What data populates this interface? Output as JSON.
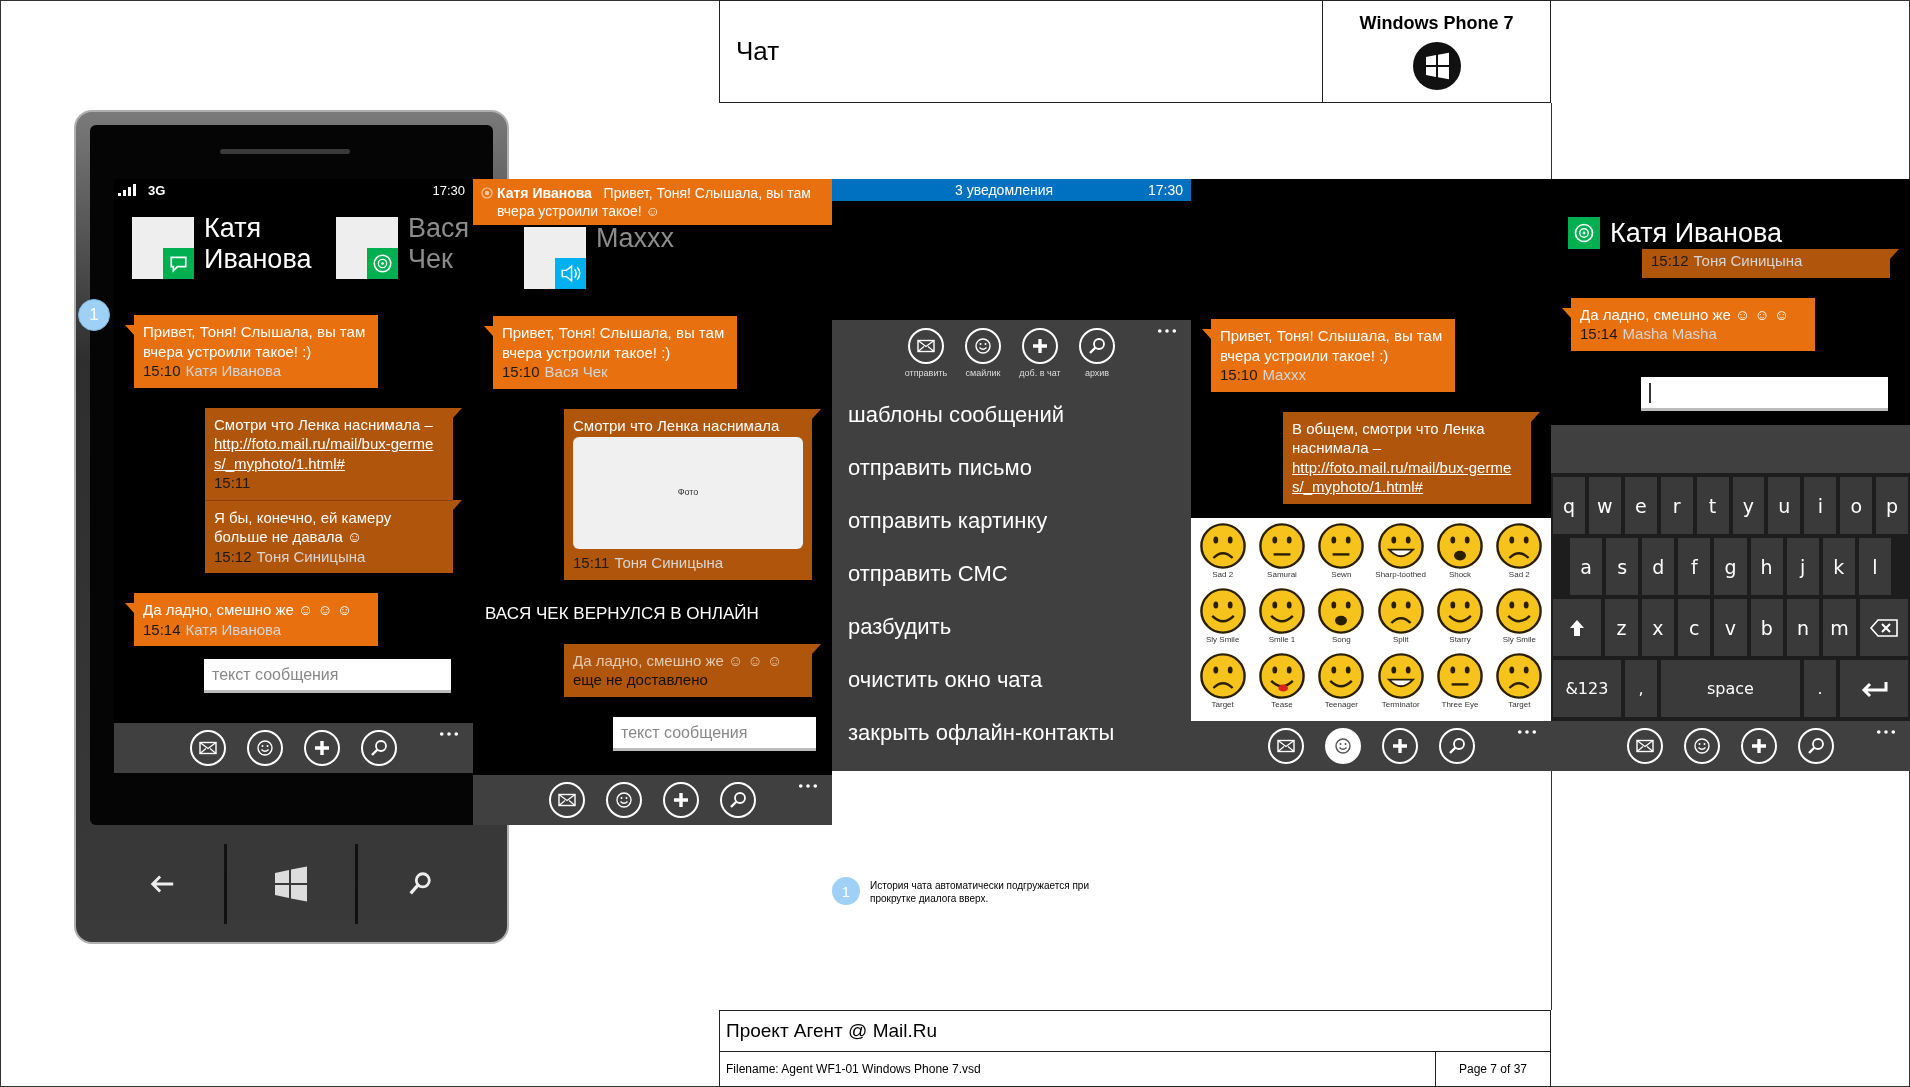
{
  "header": {
    "title": "Чат",
    "platform": "Windows Phone 7"
  },
  "screens": [
    {
      "status": {
        "kind": "phone",
        "network": "3G",
        "time": "17:30"
      },
      "contacts": [
        {
          "name": "Катя Иванова",
          "selected": true,
          "kind": "chat",
          "color": "#00b050"
        },
        {
          "name": "Вася Чек",
          "selected": false,
          "kind": "target",
          "color": "#00b050"
        }
      ],
      "messages": [
        {
          "kind": "in",
          "text": "Привет, Тоня! Слышала, вы там вчера устроили такое! :)",
          "time": "15:10",
          "author": "Катя Иванова"
        },
        {
          "kind": "out",
          "text": "Смотри что Ленка наснимала –",
          "link": "http://foto.mail.ru/mail/bux-germes/_myphoto/1.html#",
          "time": "15:11"
        },
        {
          "kind": "out",
          "text": "Я бы, конечно, ей камеру больше не давала ☺",
          "time": "15:12",
          "author": "Тоня Синицына"
        },
        {
          "kind": "in",
          "text": "Да ладно, смешно же ☺ ☺ ☺",
          "time": "15:14",
          "author": "Катя Иванова"
        }
      ],
      "input": {
        "placeholder": "текст сообщения"
      },
      "app_bar": {
        "buttons": [
          {
            "kind": "mail",
            "selected": false
          },
          {
            "kind": "smiley",
            "selected": false
          },
          {
            "kind": "add",
            "selected": false
          },
          {
            "kind": "search",
            "selected": false
          }
        ]
      }
    },
    {
      "toast": {
        "text": "**Катя Иванова**   Привет, Тоня! Слышала, вы там вчера устроили такое! ☺"
      },
      "contacts": [
        {
          "name": "Maxxx",
          "selected": false,
          "kind": "speaker",
          "color": "#00b0f0"
        }
      ],
      "messages": [
        {
          "kind": "in",
          "text": "Привет, Тоня! Слышала, вы там вчера устроили такое! :)",
          "time": "15:10",
          "author": "Вася Чек"
        },
        {
          "kind": "out",
          "text": "Смотри что Ленка наснимала",
          "photo": "Фото",
          "time": "15:11",
          "author": "Тоня Синицына"
        },
        {
          "kind": "system",
          "text": "ВАСЯ ЧЕК ВЕРНУЛСЯ В ОНЛАЙН"
        },
        {
          "kind": "out",
          "text": "Да ладно, смешно же ☺ ☺ ☺",
          "pending": true,
          "status": "еще не доставлено"
        }
      ],
      "input": {
        "placeholder": "текст сообщения"
      },
      "app_bar": {
        "buttons": [
          {
            "kind": "mail",
            "selected": false
          },
          {
            "kind": "smiley",
            "selected": false
          },
          {
            "kind": "add",
            "selected": false
          },
          {
            "kind": "search",
            "selected": false
          }
        ]
      }
    },
    {
      "status": {
        "kind": "notification",
        "title": "3 уведомления",
        "time": "17:30"
      },
      "app_bar": {
        "buttons": [
          {
            "kind": "mail",
            "selected": false,
            "label": "отправить"
          },
          {
            "kind": "smiley",
            "selected": false,
            "label": "смайлик"
          },
          {
            "kind": "add",
            "selected": false,
            "label": "доб. в чат"
          },
          {
            "kind": "search",
            "selected": false,
            "label": "архив"
          }
        ],
        "menu": [
          "шаблоны сообщений",
          "отправить письмо",
          "отправить картинку",
          "отправить СМС",
          "разбудить",
          "очистить окно чата",
          "закрыть офлайн-контакты"
        ]
      }
    },
    {
      "messages": [
        {
          "kind": "in",
          "text": "Привет, Тоня! Слышала, вы там вчера устроили такое! :)",
          "time": "15:10",
          "author": "Maxxx"
        },
        {
          "kind": "out",
          "text": "В общем, смотри что Ленка наснимала –",
          "link": "http://foto.mail.ru/mail/bux-germes/_myphoto/1.html#"
        }
      ],
      "emoji": [
        {
          "label": "Sad 2",
          "kind": "sad"
        },
        {
          "label": "Samurai",
          "kind": "neutral"
        },
        {
          "label": "Sewn",
          "kind": "neutral"
        },
        {
          "label": "Sharp-toothed",
          "kind": "grin"
        },
        {
          "label": "Shock",
          "kind": "surprised"
        },
        {
          "label": "Sad 2",
          "kind": "sad"
        },
        {
          "label": "Sly Smile",
          "kind": "smile"
        },
        {
          "label": "Smile 1",
          "kind": "smile"
        },
        {
          "label": "Song",
          "kind": "surprised"
        },
        {
          "label": "Split",
          "kind": "sad"
        },
        {
          "label": "Starry",
          "kind": "smile"
        },
        {
          "label": "Sly Smile",
          "kind": "smile"
        },
        {
          "label": "Target",
          "kind": "sad"
        },
        {
          "label": "Tease",
          "kind": "tongue"
        },
        {
          "label": "Teenager",
          "kind": "smile"
        },
        {
          "label": "Terminator",
          "kind": "grin"
        },
        {
          "label": "Three Eye",
          "kind": "neutral"
        },
        {
          "label": "Target",
          "kind": "sad"
        }
      ],
      "app_bar": {
        "buttons": [
          {
            "kind": "mail",
            "selected": false
          },
          {
            "kind": "smiley",
            "selected": true
          },
          {
            "kind": "add",
            "selected": false
          },
          {
            "kind": "search",
            "selected": false
          }
        ]
      }
    },
    {
      "header": {
        "name": "Катя Иванова",
        "kind": "target",
        "color": "#00b050"
      },
      "messages": [
        {
          "kind": "out",
          "time": "15:12",
          "author": "Тоня Синицына"
        },
        {
          "kind": "in",
          "text": "Да ладно, смешно же ☺ ☺ ☺",
          "time": "15:14",
          "author": "Masha Masha"
        }
      ],
      "input": {
        "focused": true
      },
      "keyboard": [
        [
          {
            "kind": "letter",
            "label": "q"
          },
          {
            "kind": "letter",
            "label": "w"
          },
          {
            "kind": "letter",
            "label": "e"
          },
          {
            "kind": "letter",
            "label": "r"
          },
          {
            "kind": "letter",
            "label": "t"
          },
          {
            "kind": "letter",
            "label": "y"
          },
          {
            "kind": "letter",
            "label": "u"
          },
          {
            "kind": "letter",
            "label": "i"
          },
          {
            "kind": "letter",
            "label": "o"
          },
          {
            "kind": "letter",
            "label": "p"
          }
        ],
        [
          {
            "kind": "letter",
            "label": "a"
          },
          {
            "kind": "letter",
            "label": "s"
          },
          {
            "kind": "letter",
            "label": "d"
          },
          {
            "kind": "letter",
            "label": "f"
          },
          {
            "kind": "letter",
            "label": "g"
          },
          {
            "kind": "letter",
            "label": "h"
          },
          {
            "kind": "letter",
            "label": "j"
          },
          {
            "kind": "letter",
            "label": "k"
          },
          {
            "kind": "letter",
            "label": "l"
          }
        ],
        [
          {
            "kind": "shift"
          },
          {
            "kind": "letter",
            "label": "z"
          },
          {
            "kind": "letter",
            "label": "x"
          },
          {
            "kind": "letter",
            "label": "c"
          },
          {
            "kind": "letter",
            "label": "v"
          },
          {
            "kind": "letter",
            "label": "b"
          },
          {
            "kind": "letter",
            "label": "n"
          },
          {
            "kind": "letter",
            "label": "m"
          },
          {
            "kind": "backspace"
          }
        ],
        [
          {
            "kind": "symbols",
            "label": "&123"
          },
          {
            "kind": "punct",
            "label": ","
          },
          {
            "kind": "space",
            "label": "space"
          },
          {
            "kind": "punct",
            "label": "."
          },
          {
            "kind": "enter"
          }
        ]
      ],
      "app_bar": {
        "buttons": [
          {
            "kind": "mail",
            "selected": false
          },
          {
            "kind": "smiley",
            "selected": false
          },
          {
            "kind": "add",
            "selected": false
          },
          {
            "kind": "search",
            "selected": false
          }
        ]
      }
    }
  ],
  "annotations": {
    "marker": "1",
    "note": {
      "number": "1",
      "text": "История чата автоматически подгружается при прокрутке диалога вверх."
    }
  },
  "footer": {
    "project": "Проект Агент @ Mail.Ru",
    "filename": "Filename: Agent WF1-01 Windows Phone 7.vsd",
    "page": "Page 7 of 37"
  }
}
